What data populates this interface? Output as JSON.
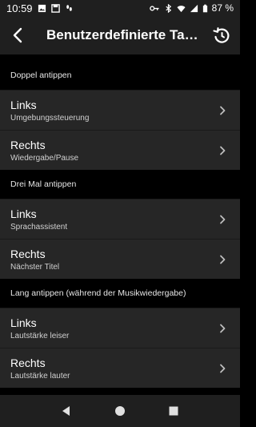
{
  "status": {
    "time": "10:59",
    "battery": "87 %"
  },
  "header": {
    "title": "Benutzerdefinierte Tast…"
  },
  "sections": [
    {
      "label": "Doppel antippen",
      "rows": [
        {
          "title": "Links",
          "subtitle": "Umgebungssteuerung"
        },
        {
          "title": "Rechts",
          "subtitle": "Wiedergabe/Pause"
        }
      ]
    },
    {
      "label": "Drei Mal antippen",
      "rows": [
        {
          "title": "Links",
          "subtitle": "Sprachassistent"
        },
        {
          "title": "Rechts",
          "subtitle": "Nächster Titel"
        }
      ]
    },
    {
      "label": "Lang antippen (während der Musikwiedergabe)",
      "rows": [
        {
          "title": "Links",
          "subtitle": "Lautstärke leiser"
        },
        {
          "title": "Rechts",
          "subtitle": "Lautstärke lauter"
        }
      ]
    }
  ]
}
